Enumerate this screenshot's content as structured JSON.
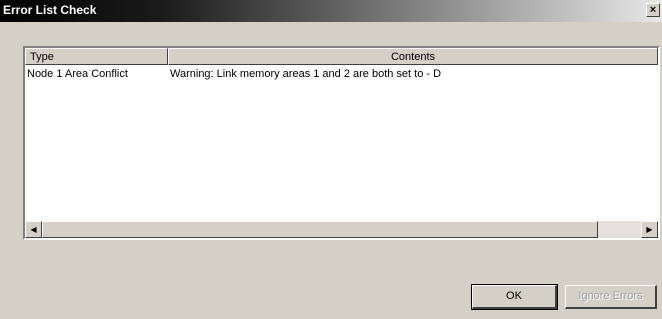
{
  "window": {
    "title": "Error List Check",
    "close_label": "×"
  },
  "list": {
    "columns": [
      "Type",
      "Contents"
    ],
    "rows": [
      {
        "type": "Node 1 Area Conflict",
        "contents": "Warning: Link memory areas 1 and 2 are both set to - D"
      }
    ]
  },
  "scrollbar": {
    "left_arrow": "◀",
    "right_arrow": "▶"
  },
  "buttons": {
    "ok_label": "OK",
    "ignore_label": "Ignore Errors"
  }
}
